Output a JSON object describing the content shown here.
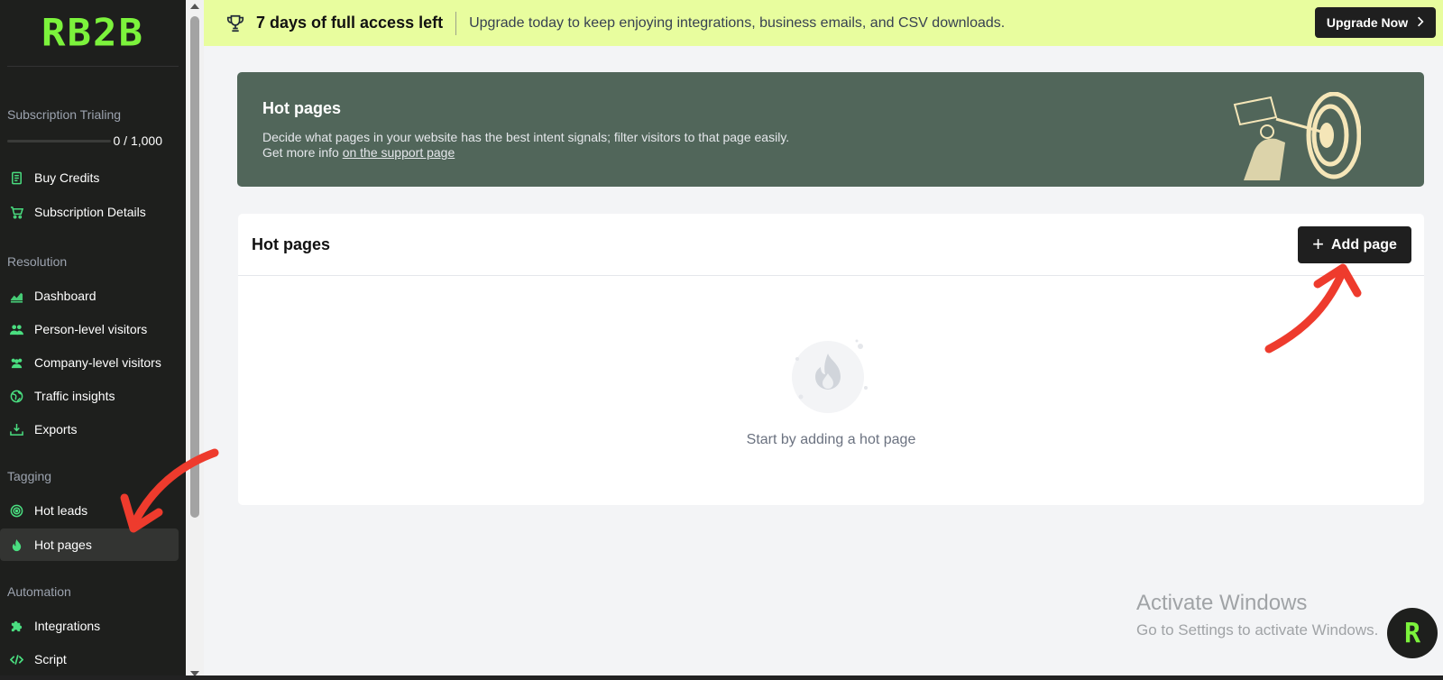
{
  "sidebar": {
    "logo": "RB2B",
    "subscription": {
      "title": "Subscription Trialing",
      "credits": "0 / 1,000"
    },
    "billing_items": [
      {
        "label": "Buy Credits",
        "icon": "receipt-icon"
      },
      {
        "label": "Subscription Details",
        "icon": "cart-icon"
      }
    ],
    "sections": {
      "resolution": "Resolution",
      "tagging": "Tagging",
      "automation": "Automation"
    },
    "resolution_items": [
      {
        "label": "Dashboard",
        "icon": "chart-icon"
      },
      {
        "label": "Person-level visitors",
        "icon": "users-icon"
      },
      {
        "label": "Company-level visitors",
        "icon": "company-users-icon"
      },
      {
        "label": "Traffic insights",
        "icon": "globe-icon"
      },
      {
        "label": "Exports",
        "icon": "download-icon"
      }
    ],
    "tagging_items": [
      {
        "label": "Hot leads",
        "icon": "target-icon"
      },
      {
        "label": "Hot pages",
        "icon": "flame-icon",
        "active": true
      }
    ],
    "automation_items": [
      {
        "label": "Integrations",
        "icon": "puzzle-icon"
      },
      {
        "label": "Script",
        "icon": "code-icon"
      }
    ]
  },
  "banner": {
    "title": "7 days of full access left",
    "message": "Upgrade today to keep enjoying integrations, business emails, and CSV downloads.",
    "button": "Upgrade Now",
    "bg_color": "#e8fd9e"
  },
  "hero": {
    "title": "Hot pages",
    "description": "Decide what pages in your website has the best intent signals; filter visitors to that page easily.",
    "more_prefix": "Get more info ",
    "link_text": "on the support page",
    "bg_color": "#51665a"
  },
  "card": {
    "title": "Hot pages",
    "add_button": "Add page",
    "empty_text": "Start by adding a hot page"
  },
  "watermark": {
    "title": "Activate Windows",
    "subtitle": "Go to Settings to activate Windows."
  },
  "brand": {
    "accent": "#7cf33c",
    "icon_green": "#4ade80",
    "dark": "#1e1f1d"
  }
}
